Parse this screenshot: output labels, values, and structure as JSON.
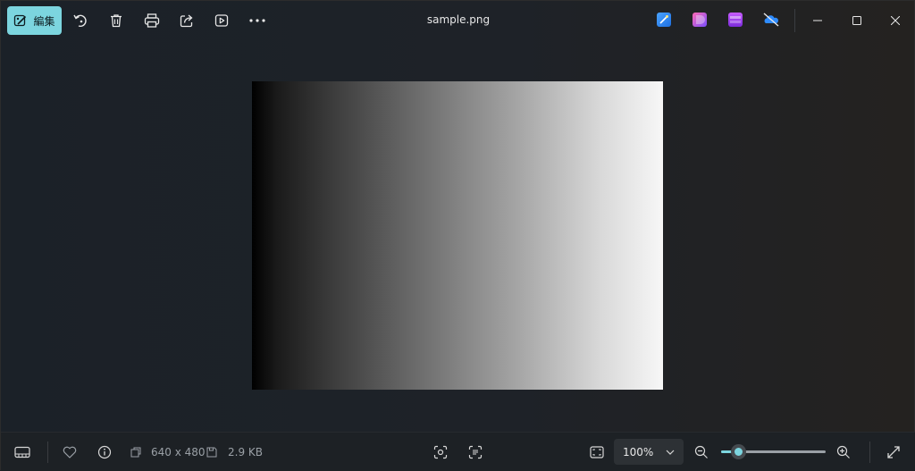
{
  "toolbar": {
    "edit_label": "編集",
    "edit_icon": "edit-image-icon",
    "icons": [
      "rotate-icon",
      "delete-icon",
      "print-icon",
      "share-icon",
      "slideshow-icon",
      "more-icon"
    ]
  },
  "window": {
    "title": "sample.png",
    "apps": [
      "designer-icon",
      "clipchamp-icon",
      "photos-legacy-icon",
      "onedrive-off-icon"
    ],
    "controls": [
      "minimize-icon",
      "maximize-icon",
      "close-icon"
    ]
  },
  "image": {
    "width": 640,
    "height": 480,
    "gradient": [
      "#000000",
      "#ffffff"
    ]
  },
  "status": {
    "dimensions": "640 x 480",
    "file_size": "2.9 KB"
  },
  "zoom": {
    "value_label": "100%",
    "level": 0.17
  },
  "colors": {
    "accent": "#7cd5df",
    "background": "#1e2228"
  }
}
